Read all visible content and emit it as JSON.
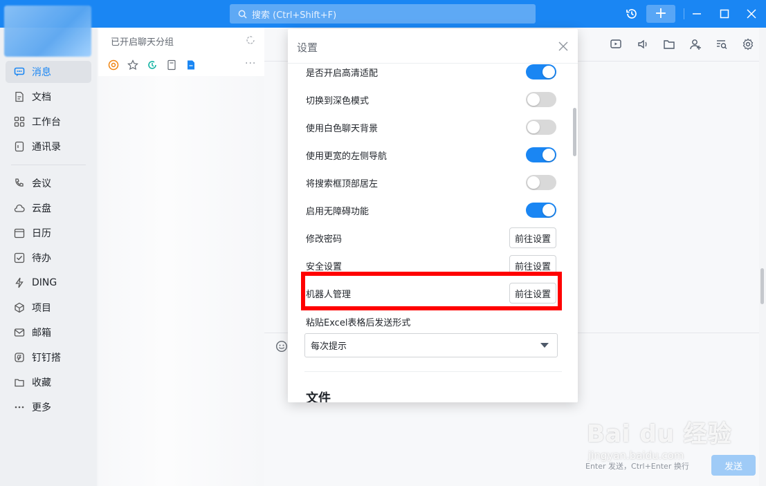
{
  "topbar": {
    "search_placeholder": "搜索 (Ctrl+Shift+F)",
    "icons": [
      "history-icon",
      "plus-icon",
      "minimize-icon",
      "maximize-icon",
      "close-icon"
    ]
  },
  "sidebar": {
    "items": [
      {
        "label": "消息",
        "icon": "message-icon",
        "active": true
      },
      {
        "label": "文档",
        "icon": "document-icon"
      },
      {
        "label": "工作台",
        "icon": "grid-icon"
      },
      {
        "label": "通讯录",
        "icon": "contacts-icon"
      },
      {
        "label": "会议",
        "icon": "phone-icon"
      },
      {
        "label": "云盘",
        "icon": "cloud-icon"
      },
      {
        "label": "日历",
        "icon": "calendar-icon"
      },
      {
        "label": "待办",
        "icon": "todo-icon"
      },
      {
        "label": "DING",
        "icon": "bolt-icon"
      },
      {
        "label": "项目",
        "icon": "project-icon"
      },
      {
        "label": "邮箱",
        "icon": "mail-icon"
      },
      {
        "label": "钉钉搭",
        "icon": "build-icon"
      },
      {
        "label": "收藏",
        "icon": "favorite-icon"
      },
      {
        "label": "更多",
        "icon": "more-icon"
      }
    ]
  },
  "convlist": {
    "group_title": "已开启聊天分组",
    "more": "···"
  },
  "settings": {
    "title": "设置",
    "toggles": [
      {
        "label": "是否开启高清适配",
        "on": true
      },
      {
        "label": "切换到深色模式",
        "on": false
      },
      {
        "label": "使用白色聊天背景",
        "on": false
      },
      {
        "label": "使用更宽的左侧导航",
        "on": true
      },
      {
        "label": "将搜索框顶部居左",
        "on": false
      },
      {
        "label": "启用无障碍功能",
        "on": true
      }
    ],
    "links": [
      {
        "label": "修改密码",
        "button": "前往设置"
      },
      {
        "label": "安全设置",
        "button": "前往设置"
      },
      {
        "label": "机器人管理",
        "button": "前往设置"
      }
    ],
    "paste_label": "粘贴Excel表格后发送形式",
    "paste_value": "每次提示",
    "next_section": "文件"
  },
  "chat": {
    "enter_hint": "Enter 发送，Ctrl+Enter 换行",
    "send_label": "发送"
  },
  "watermark": {
    "brand": "Bai du 经验",
    "url": "jingyan.baidu.com"
  },
  "colors": {
    "accent": "#1a86f3",
    "highlight": "#ff0000"
  }
}
